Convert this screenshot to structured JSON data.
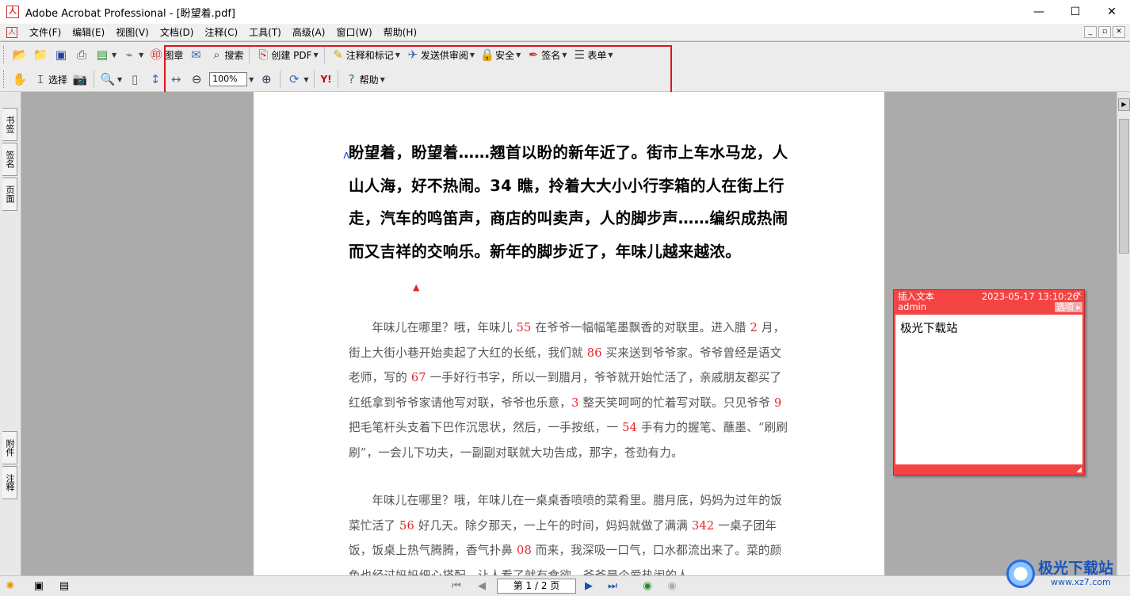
{
  "window": {
    "title": "Adobe Acrobat Professional - [盼望着.pdf]",
    "app_icon_glyph": "人",
    "minimize_glyph": "—",
    "maximize_glyph": "☐",
    "close_glyph": "✕"
  },
  "menu": {
    "doc_icon_glyph": "人",
    "items": [
      "文件(F)",
      "编辑(E)",
      "视图(V)",
      "文档(D)",
      "注释(C)",
      "工具(T)",
      "高级(A)",
      "窗口(W)",
      "帮助(H)"
    ],
    "mdi_buttons": [
      "_",
      "▫",
      "✕"
    ]
  },
  "toolbar1": {
    "stamp_label": "图章",
    "search_label": "搜索",
    "create_pdf_label": "创建 PDF",
    "comment_markup_label": "注释和标记",
    "send_review_label": "发送供审阅",
    "security_label": "安全",
    "sign_label": "签名",
    "forms_label": "表单"
  },
  "toolbar2": {
    "select_label": "选择",
    "zoom_value": "100%",
    "help_label": "帮助",
    "yahoo_label": "Y!"
  },
  "left_tabs": [
    "书签",
    "签名",
    "页面",
    "附件",
    "注释"
  ],
  "document": {
    "heading": "盼望着，盼望着……翘首以盼的新年近了。街市上车水马龙，人山人海，好不热闹。34 瞧，拎着大大小小行李箱的人在街上行走，汽车的鸣笛声，商店的叫卖声，人的脚步声……编织成热闹而又吉祥的交响乐。新年的脚步近了，年味儿越来越浓。",
    "para1": [
      {
        "t": "年味儿在哪里？哦，年味儿 "
      },
      {
        "n": "55"
      },
      {
        "t": " 在爷爷一幅幅笔墨飘香的对联里。进入腊 "
      },
      {
        "n": "2"
      },
      {
        "t": " 月，街上大街小巷开始卖起了大红的长纸，我们就 "
      },
      {
        "n": "86"
      },
      {
        "t": " 买来送到爷爷家。爷爷曾经是语文老师，写的 "
      },
      {
        "n": "67"
      },
      {
        "t": " 一手好行书字，所以一到腊月，爷爷就开始忙活了，亲戚朋友都买了红纸拿到爷爷家请他写对联，爷爷也乐意，"
      },
      {
        "n": "3"
      },
      {
        "t": " 整天笑呵呵的忙着写对联。只见爷爷 "
      },
      {
        "n": "9"
      },
      {
        "t": " 把毛笔杆头支着下巴作沉思状，然后，一手按纸，一 "
      },
      {
        "n": "54"
      },
      {
        "t": " 手有力的握笔、蘸墨、“刷刷刷”，一会儿下功夫，一副副对联就大功告成，那字，苍劲有力。"
      }
    ],
    "para2": [
      {
        "t": "年味儿在哪里？哦，年味儿在一桌桌香喷喷的菜肴里。腊月底，妈妈为过年的饭菜忙活了 "
      },
      {
        "n": "56"
      },
      {
        "t": " 好几天。除夕那天，一上午的时间，妈妈就做了满满 "
      },
      {
        "n": "342"
      },
      {
        "t": " 一桌子团年饭，饭桌上热气腾腾，香气扑鼻 "
      },
      {
        "n": "08"
      },
      {
        "t": " 而来，我深吸一口气，口水都流出来了。菜的颜色也经过妈妈细心搭配，让人看了就有食欲，爷爷是个爱热闹的人"
      }
    ]
  },
  "note": {
    "title": "插入文本",
    "timestamp": "2023-05-17 13:10:26",
    "author": "admin",
    "options_label": "选项",
    "content": "极光下载站",
    "close_glyph": "✕"
  },
  "status": {
    "page_indicator": "第 1 / 2 页"
  },
  "watermark": {
    "text": "极光下载站",
    "url": "www.xz7.com"
  },
  "colors": {
    "highlight_box": "#e0141e",
    "note_bg": "#f44343",
    "number_red": "#e3262d"
  }
}
